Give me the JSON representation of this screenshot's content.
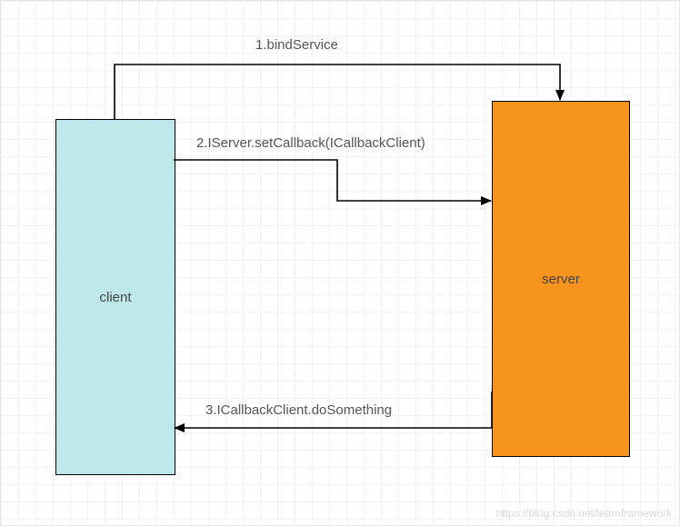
{
  "nodes": {
    "client": {
      "label": "client"
    },
    "server": {
      "label": "server"
    }
  },
  "arrows": {
    "a1": {
      "label": "1.bindService"
    },
    "a2": {
      "label": "2.IServer.setCallback(ICallbackClient)"
    },
    "a3": {
      "label": "3.ICallbackClient.doSomething"
    }
  },
  "watermark": "https://blog.csdn.net/learnframework"
}
